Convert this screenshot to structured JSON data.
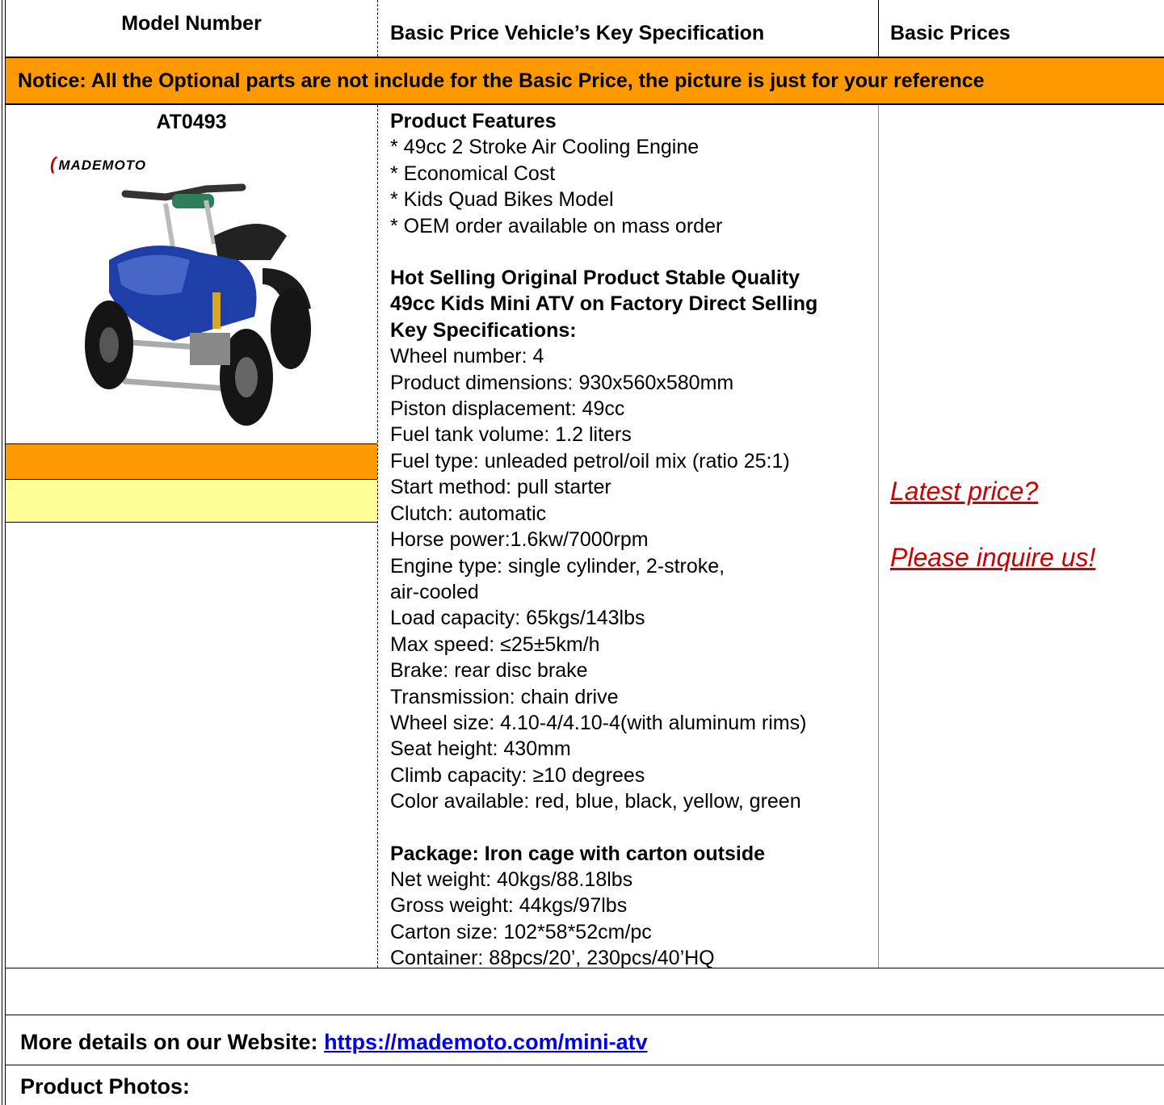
{
  "header": {
    "col1": "Model Number",
    "col2": "Basic Price Vehicle’s Key Specification",
    "col3": "Basic Prices"
  },
  "notice": "Notice: All the Optional parts are not include for the Basic Price, the picture is just for your reference",
  "product": {
    "model": "AT0493",
    "logo_text": "MADEMOTO",
    "features_title": "Product Features",
    "features": [
      "* 49cc 2 Stroke Air Cooling Engine",
      "* Economical Cost",
      "* Kids Quad Bikes Model",
      "* OEM order available on mass order"
    ],
    "headline": [
      "Hot Selling Original Product Stable Quality",
      "49cc Kids Mini ATV on Factory Direct Selling",
      "Key Specifications:"
    ],
    "specs": [
      "Wheel number: 4",
      "Product dimensions: 930x560x580mm",
      "Piston displacement: 49cc",
      "Fuel tank volume: 1.2 liters",
      "Fuel type: unleaded petrol/oil mix (ratio 25:1)",
      "Start method: pull starter",
      "Clutch: automatic",
      "Horse power:1.6kw/7000rpm",
      "Engine type: single cylinder, 2-stroke,",
      "air-cooled",
      "Load capacity: 65kgs/143lbs",
      "Max speed: ≤25±5km/h",
      "Brake: rear disc brake",
      "Transmission: chain drive",
      "Wheel size: 4.10-4/4.10-4(with aluminum rims)",
      "Seat height: 430mm",
      "Climb capacity: ≥10 degrees",
      "Color available: red, blue, black, yellow, green"
    ],
    "package_title": "Package: Iron cage with carton outside",
    "package": [
      "Net weight: 40kgs/88.18lbs",
      "Gross weight: 44kgs/97lbs",
      "Carton size: 102*58*52cm/pc",
      "Container: 88pcs/20’, 230pcs/40’HQ"
    ],
    "price_line1": "Latest price? ",
    "price_line2": "Please inquire us!"
  },
  "website_label": "More details on our Website: ",
  "website_url": "https://mademoto.com/mini-atv",
  "photos_label": "Product Photos:"
}
